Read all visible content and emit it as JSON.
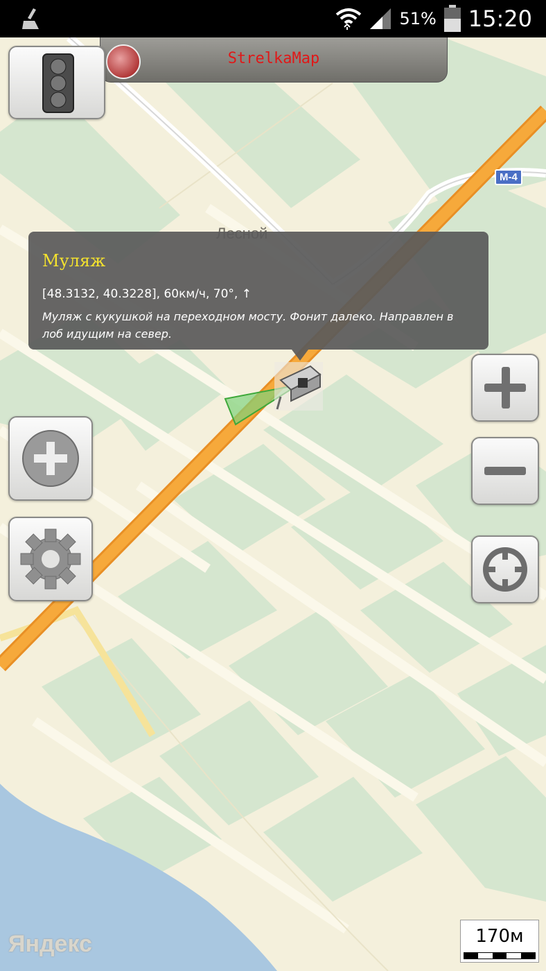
{
  "status_bar": {
    "battery_percent": "51%",
    "time": "15:20",
    "icons": [
      "clean-master-icon",
      "wifi-icon",
      "signal-icon",
      "battery-icon"
    ]
  },
  "top_bar": {
    "title": "StrelkaMap",
    "logo": "strelka-logo-icon"
  },
  "map": {
    "place_label": "Лесной",
    "road_label": "М-4",
    "provider_label": "Яндекс",
    "scale_label": "170м"
  },
  "popup": {
    "title": "Муляж",
    "info": "[48.3132, 40.3228], 60км/ч, 70°, ↑",
    "description": "Муляж с кукушкой на переходном мосту. Фонит далеко. Направлен в лоб идущим на север."
  },
  "buttons": {
    "traffic_light": "traffic-light-icon",
    "add": "plus-circle-icon",
    "settings": "gear-icon",
    "zoom_in": "zoom-in-icon",
    "zoom_out": "zoom-out-icon",
    "locate": "crosshair-icon"
  },
  "colors": {
    "title_red": "#e01818",
    "popup_title_yellow": "#f4e22e",
    "highway_orange": "#f6a93b",
    "water_blue": "#a9c7e0",
    "park_green": "#d5e6cf"
  }
}
